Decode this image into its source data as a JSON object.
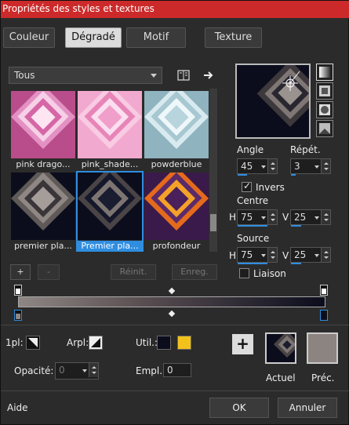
{
  "window": {
    "title": "Propriétés des styles et textures"
  },
  "tabs": [
    {
      "label": "Couleur",
      "active": false
    },
    {
      "label": "Dégradé",
      "active": true
    },
    {
      "label": "Motif",
      "active": false
    },
    {
      "label": "Texture",
      "active": false
    }
  ],
  "category": {
    "selected": "Tous"
  },
  "thumbnails": [
    {
      "label": "pink drago...",
      "selected": false
    },
    {
      "label": "pink_shade...",
      "selected": false
    },
    {
      "label": "powderblue",
      "selected": false
    },
    {
      "label": "premier pla...",
      "selected": false
    },
    {
      "label": "Premier pla...",
      "selected": true
    },
    {
      "label": "profondeur",
      "selected": false
    }
  ],
  "params": {
    "angle_label": "Angle",
    "angle_value": "45",
    "repeat_label": "Répét.",
    "repeat_value": "3",
    "invert_label": "Invers",
    "invert_checked": true,
    "center_label": "Centre",
    "center_h_label": "H",
    "center_h_value": "75",
    "center_v_label": "V",
    "center_v_value": "25",
    "source_label": "Source",
    "source_h_label": "H",
    "source_h_value": "75",
    "source_v_label": "V",
    "source_v_value": "25",
    "link_label": "Liaison",
    "link_checked": false
  },
  "editor": {
    "add_label": "+",
    "remove_label": "-",
    "reset_label": "Réinit.",
    "save_label": "Enreg."
  },
  "bottom": {
    "first_label": "1pl:",
    "arpl_label": "Arpl:",
    "util_label": "Util.:",
    "opacity_label": "Opacité:",
    "opacity_value": "0",
    "empl_label": "Empl.:",
    "empl_value": "0",
    "current_label": "Actuel",
    "previous_label": "Préc.",
    "help_label": "Aide",
    "ok_label": "OK",
    "cancel_label": "Annuler"
  },
  "colors": {
    "accent": "#2f8de0",
    "title_bar": "#cc2a2a",
    "util_dark": "#0b0d1c",
    "util_gold": "#f2c21b",
    "previous_swatch": "#8c8481"
  }
}
